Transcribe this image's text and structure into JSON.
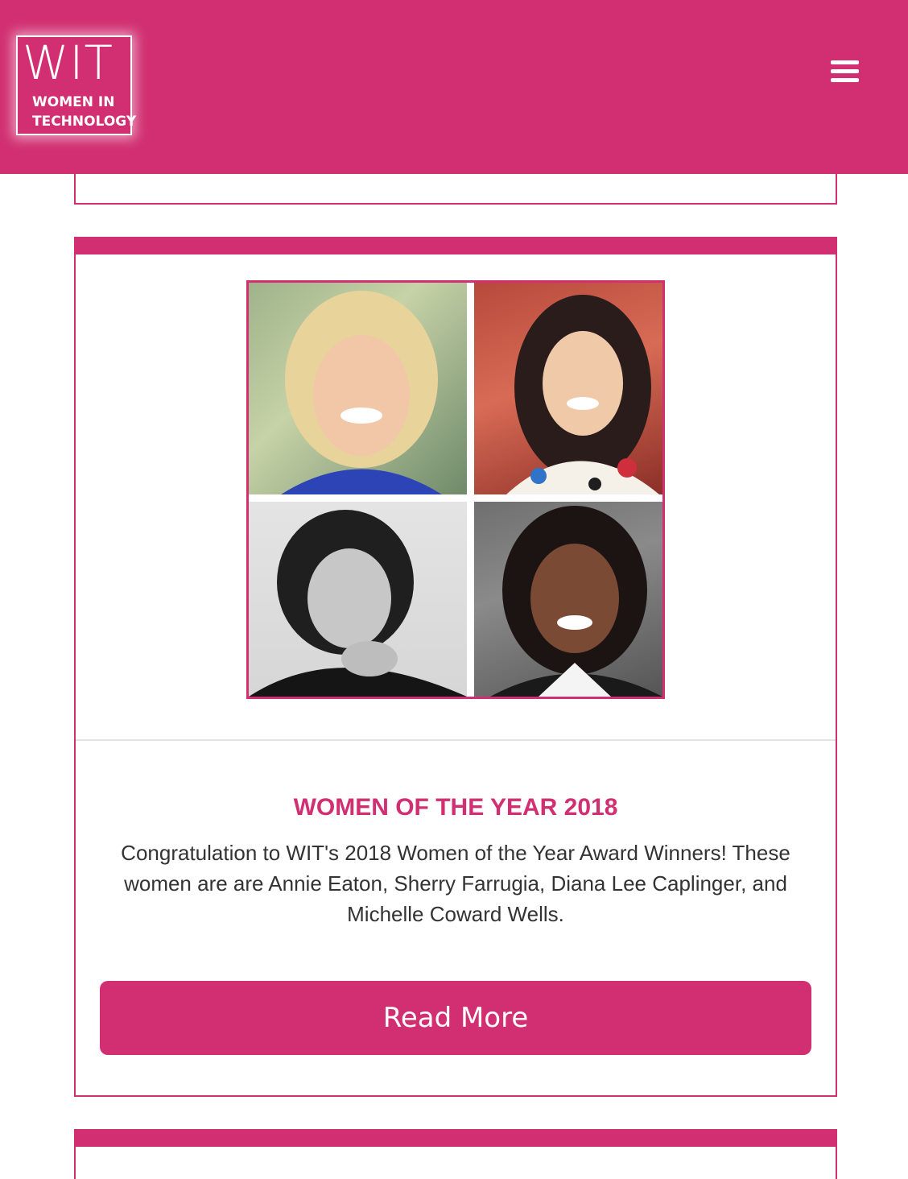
{
  "header": {
    "logo_big": "WIT",
    "logo_line1": "WOMEN IN",
    "logo_line2": "TECHNOLOGY",
    "menu_icon": "hamburger-menu-icon"
  },
  "card": {
    "title": "WOMEN OF THE YEAR 2018",
    "description": "Congratulation to WIT's 2018 Women of the Year Award Winners! These women are are Annie Eaton, Sherry Farrugia, Diana Lee Caplinger, and Michelle Coward Wells.",
    "button_label": "Read More"
  },
  "colors": {
    "brand": "#d12f71",
    "text": "#333333",
    "background": "#ffffff"
  }
}
